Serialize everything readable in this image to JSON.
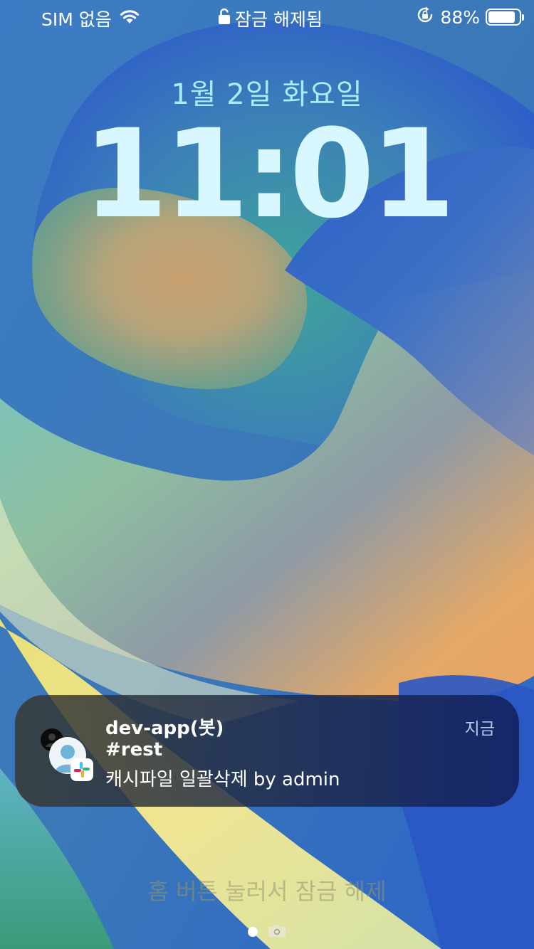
{
  "status_bar": {
    "carrier": "SIM 없음",
    "lock_status": "잠금 해제됨",
    "battery_percent_text": "88%",
    "battery_level": 0.88
  },
  "lock_screen": {
    "date": "1월 2일 화요일",
    "time": "11:01"
  },
  "notification": {
    "title": "dev-app(봇)",
    "channel": "#rest",
    "body": "캐시파일 일괄삭제 by admin",
    "time": "지금"
  },
  "bottom": {
    "home_hint": "홈 버튼 눌러서 잠금 해제"
  },
  "icons": [
    "wifi-icon",
    "lock-icon",
    "orientation-lock-icon",
    "battery-icon",
    "avatar-icon",
    "slack-icon",
    "camera-icon"
  ],
  "colors": {
    "date_text": "#a7ecff",
    "time_text": "#d9f7ff",
    "notification_time": "#b8c6ec"
  }
}
